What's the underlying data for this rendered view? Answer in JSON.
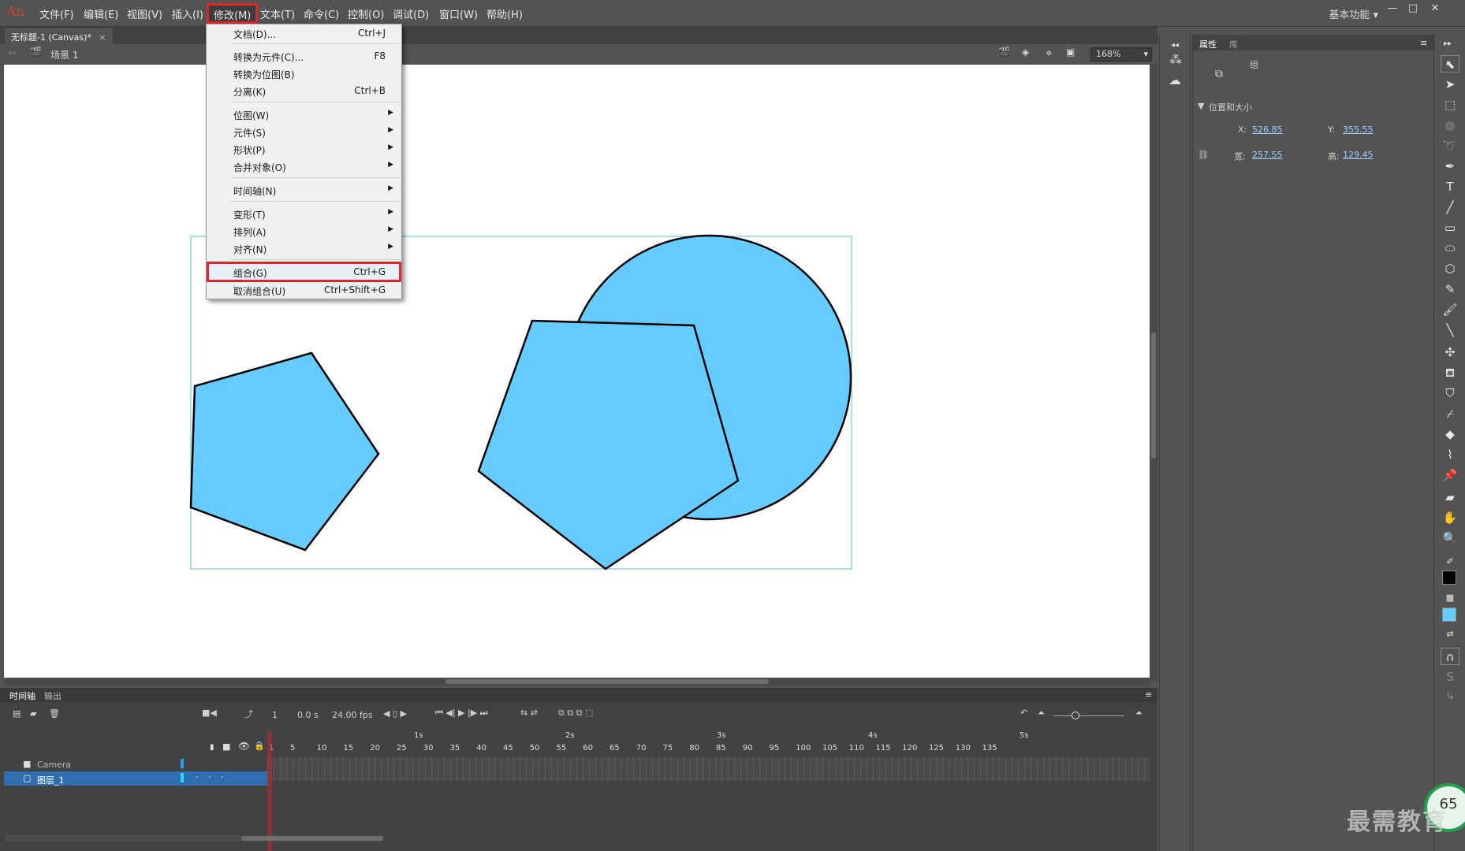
{
  "app": {
    "logo": "An"
  },
  "menubar": {
    "items": [
      "文件(F)",
      "编辑(E)",
      "视图(V)",
      "插入(I)",
      "修改(M)",
      "文本(T)",
      "命令(C)",
      "控制(O)",
      "调试(D)",
      "窗口(W)",
      "帮助(H)"
    ],
    "workspace": "基本功能"
  },
  "document": {
    "tab_title": "无标题-1 (Canvas)*",
    "scene": "场景 1",
    "zoom": "168%"
  },
  "modify_menu": {
    "items": [
      {
        "label": "文档(D)...",
        "shortcut": "Ctrl+J"
      },
      {
        "label": "转换为元件(C)...",
        "shortcut": "F8"
      },
      {
        "label": "转换为位图(B)",
        "shortcut": ""
      },
      {
        "label": "分离(K)",
        "shortcut": "Ctrl+B"
      },
      {
        "label": "位图(W)",
        "shortcut": ""
      },
      {
        "label": "元件(S)",
        "shortcut": ""
      },
      {
        "label": "形状(P)",
        "shortcut": ""
      },
      {
        "label": "合并对象(O)",
        "shortcut": ""
      },
      {
        "label": "时间轴(N)",
        "shortcut": ""
      },
      {
        "label": "变形(T)",
        "shortcut": ""
      },
      {
        "label": "排列(A)",
        "shortcut": ""
      },
      {
        "label": "对齐(N)",
        "shortcut": ""
      },
      {
        "label": "组合(G)",
        "shortcut": "Ctrl+G"
      },
      {
        "label": "取消组合(U)",
        "shortcut": "Ctrl+Shift+G"
      }
    ]
  },
  "timeline": {
    "tabs": [
      "时间轴",
      "输出"
    ],
    "current_frame": "1",
    "time": "0.0 s",
    "fps": "24.00 fps",
    "seconds": [
      "1s",
      "2s",
      "3s",
      "4s",
      "5s"
    ],
    "frame_numbers": [
      "1",
      "5",
      "10",
      "15",
      "20",
      "25",
      "30",
      "35",
      "40",
      "45",
      "50",
      "55",
      "60",
      "65",
      "70",
      "75",
      "80",
      "85",
      "90",
      "95",
      "100",
      "105",
      "110",
      "115",
      "120",
      "125",
      "130",
      "135"
    ],
    "layers": [
      {
        "name": "Camera"
      },
      {
        "name": "图层_1"
      }
    ]
  },
  "properties": {
    "tabs": [
      "属性",
      "库"
    ],
    "object_type": "组",
    "section": "位置和大小",
    "x_label": "X:",
    "x": "526.85",
    "y_label": "Y:",
    "y": "355.55",
    "w_label": "宽:",
    "w": "257.55",
    "h_label": "高:",
    "h": "129.45"
  },
  "colors": {
    "shape_fill": "#66ccff",
    "highlight": "#e02727",
    "stroke_swatch": "#000000",
    "fill_swatch": "#66ccff"
  },
  "watermark": {
    "text": "最需教育",
    "badge": "65"
  }
}
